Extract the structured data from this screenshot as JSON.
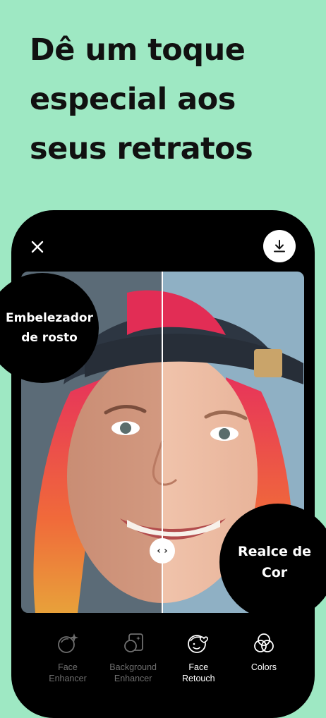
{
  "headline": "Dê um toque\nespecial aos\nseus retratos",
  "labels": {
    "face_beautifier": "Embelezador de rosto",
    "color_enhance": "Realce de Cor"
  },
  "slider_handle": "‹ ›",
  "toolbar": {
    "items": [
      {
        "label": "Face\nEnhancer",
        "icon": "face-sparkle-icon",
        "state": "dim"
      },
      {
        "label": "Background\nEnhancer",
        "icon": "portrait-frame-icon",
        "state": "dim"
      },
      {
        "label": "Face\nRetouch",
        "icon": "face-heart-icon",
        "state": "active"
      },
      {
        "label": "Colors",
        "icon": "color-circles-icon",
        "state": "active"
      }
    ]
  },
  "colors": {
    "background": "#9ee8c3",
    "phone": "#000000",
    "text_dark": "#111111",
    "inactive": "#6f6f6f"
  }
}
